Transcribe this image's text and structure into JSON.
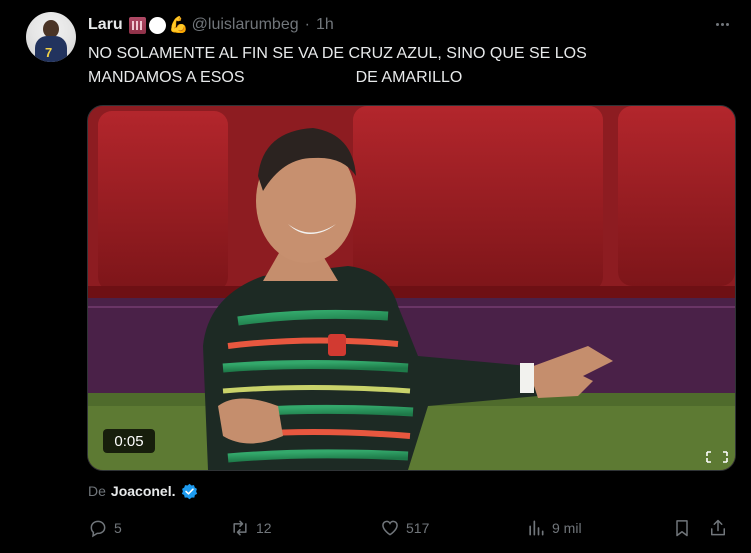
{
  "author": {
    "display_name": "Laru",
    "emojis": [
      "building-emoji",
      "ball-emoji",
      "flexed-biceps-emoji"
    ],
    "handle": "@luislarumbeg",
    "separator": "·",
    "time": "1h"
  },
  "tweet": {
    "line1": "NO SOLAMENTE AL FIN SE VA DE CRUZ AZUL, SINO QUE SE LOS",
    "line2": "MANDAMOS A ESOS                         DE AMARILLO"
  },
  "video": {
    "duration": "0:05"
  },
  "attribution": {
    "prefix": "De",
    "author": "Joaconel."
  },
  "actions": {
    "replies": "5",
    "reposts": "12",
    "likes": "517",
    "views": "9 mil"
  },
  "colors": {
    "background": "#000000",
    "text": "#e7e9ea",
    "muted": "#71767b",
    "verified": "#1d9bf0"
  }
}
